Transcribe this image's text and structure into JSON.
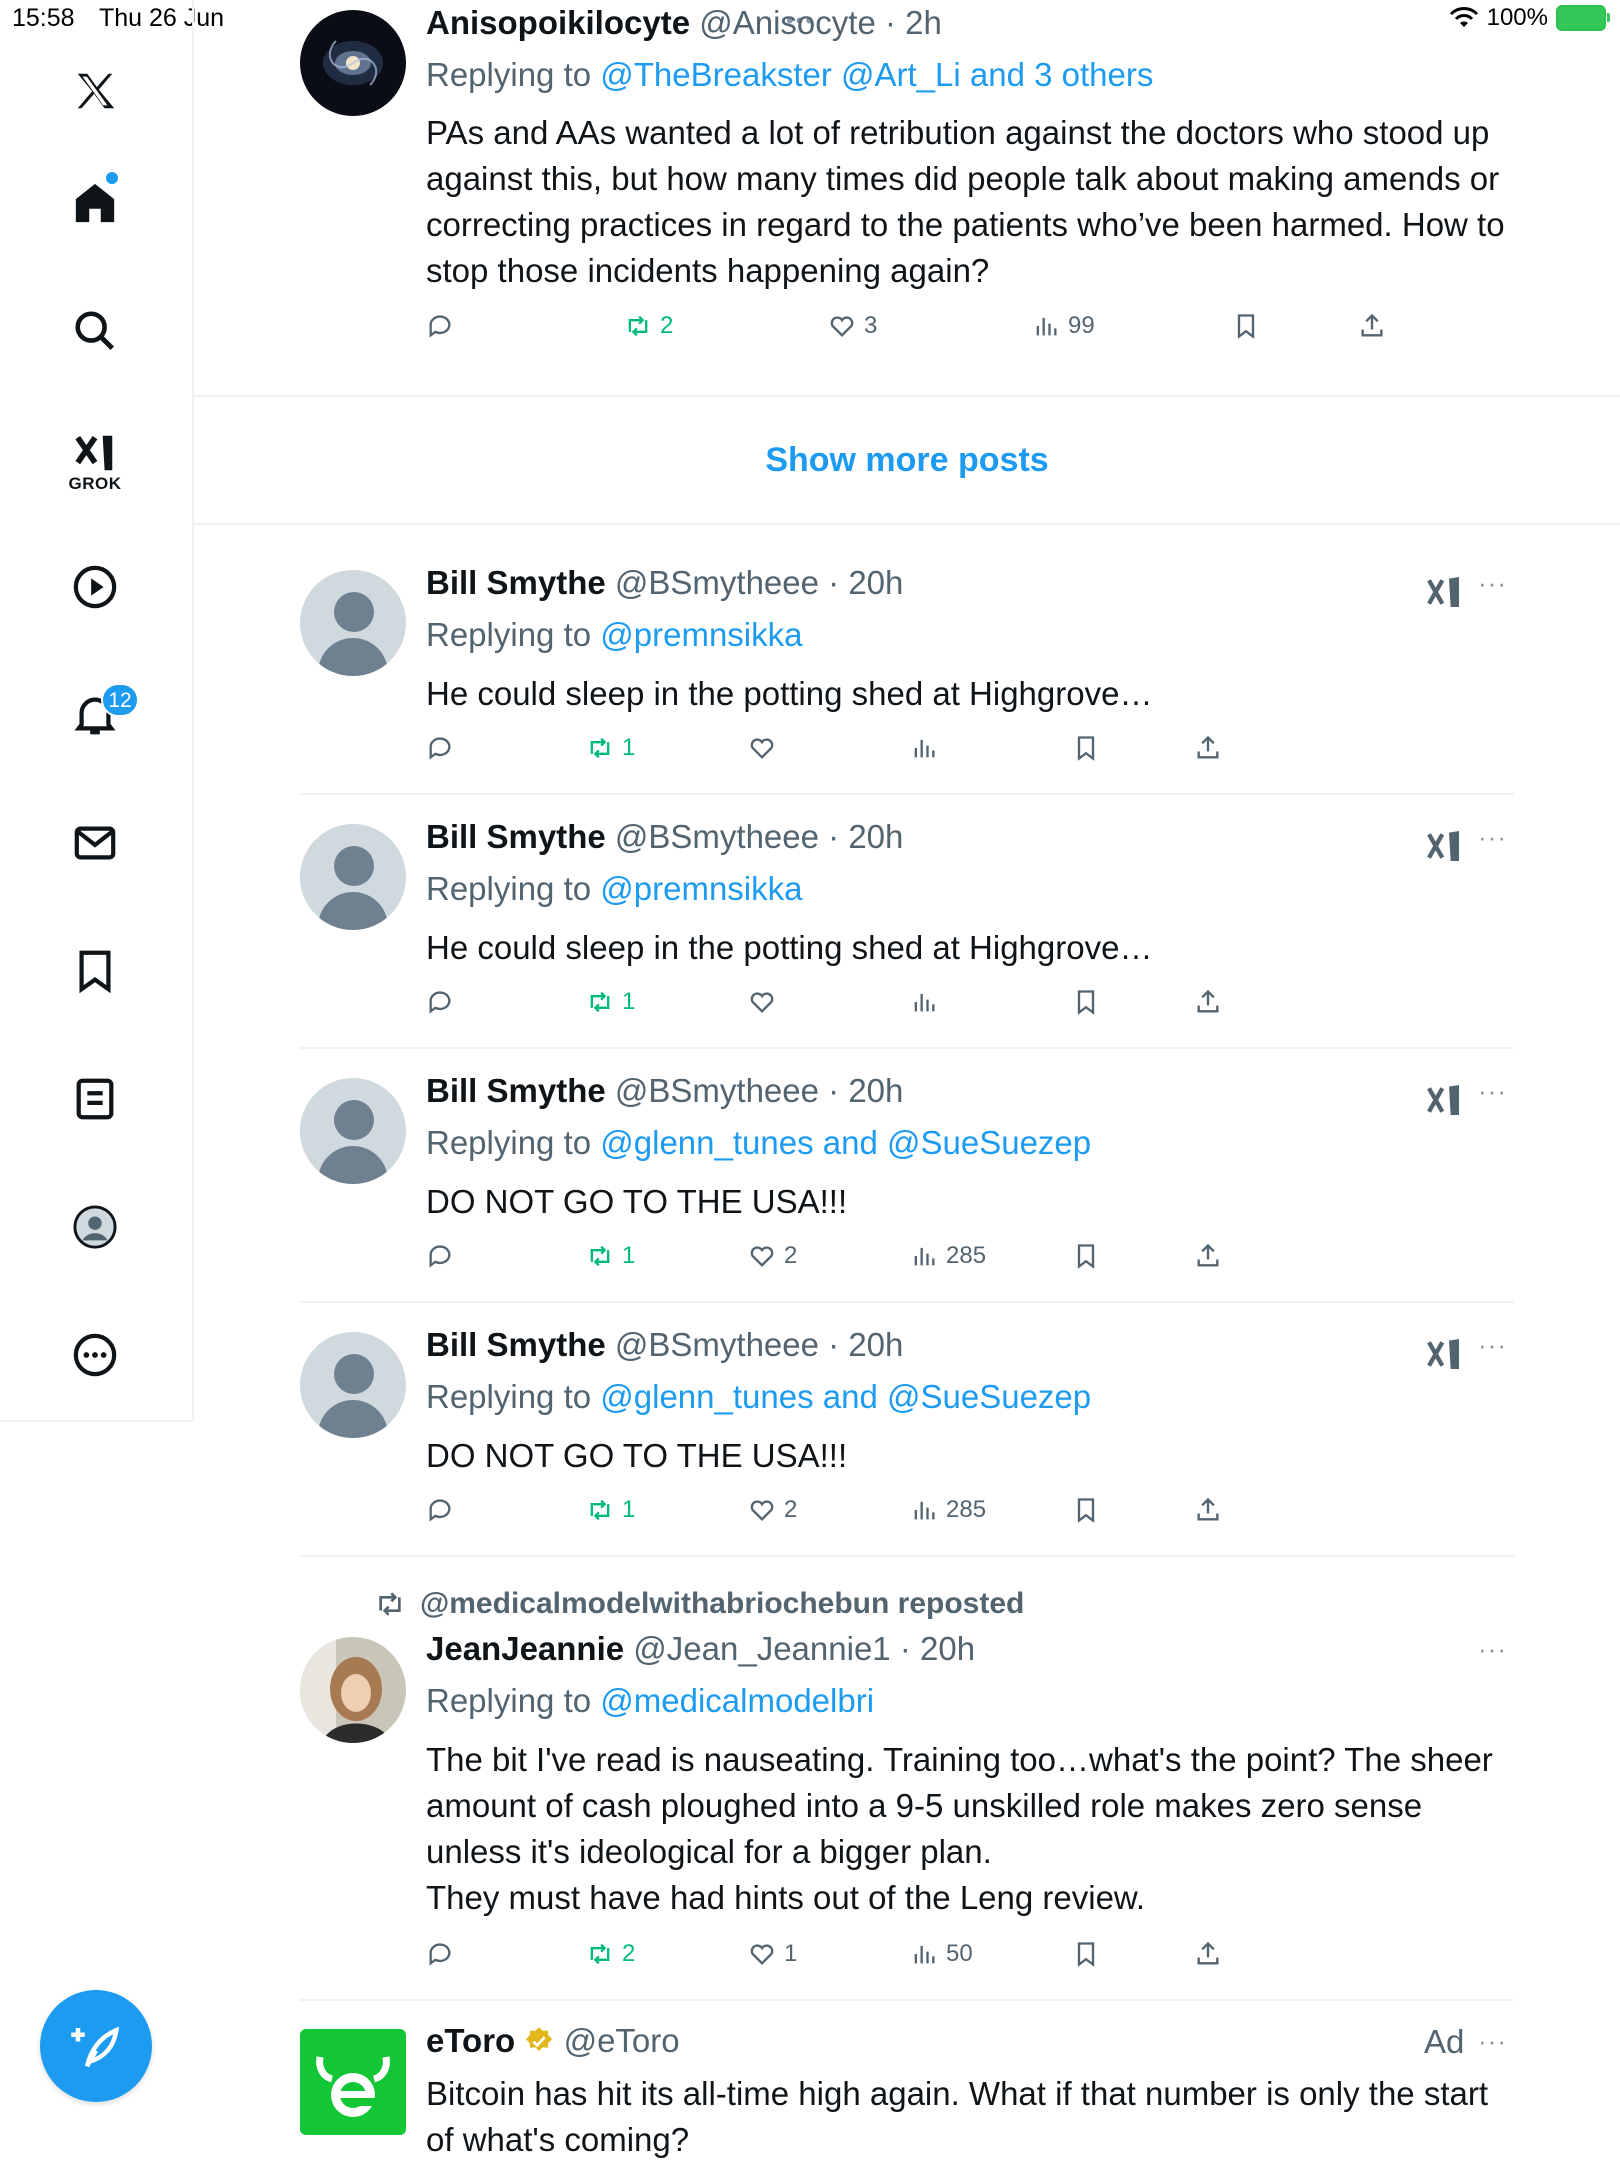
{
  "status": {
    "time": "15:58",
    "date": "Thu 26 Jun",
    "battery": "100%",
    "top_dots": "•••"
  },
  "sidebar": {
    "grok_label": "GROK",
    "notifications_badge": "12",
    "compose_label": "+"
  },
  "feed": {
    "show_more": "Show more posts"
  },
  "posts": [
    {
      "name": "Anisopoikilocyte",
      "handle": "@Anisocyte",
      "time": "· 2h",
      "replying_prefix": "Replying to ",
      "replying_to": "@TheBreakster @Art_Li and 3 others",
      "text": "PAs and AAs wanted a lot of retribution against the doctors who stood up against this, but how many times did people talk about making amends or correcting practices in regard to the patients who’ve been harmed. How to stop those incidents happening again?",
      "reposts": "2",
      "likes": "3",
      "views": "99"
    },
    {
      "name": "Bill Smythe",
      "handle": "@BSmytheee",
      "time": "· 20h",
      "replying_prefix": "Replying to ",
      "replying_to": "@premnsikka",
      "text": "He could sleep in the potting shed at Highgrove…",
      "reposts": "1",
      "likes": "",
      "views": "",
      "more": "···"
    },
    {
      "name": "Bill Smythe",
      "handle": "@BSmytheee",
      "time": "· 20h",
      "replying_prefix": "Replying to ",
      "replying_to": "@premnsikka",
      "text": "He could sleep in the potting shed at Highgrove…",
      "reposts": "1",
      "likes": "",
      "views": "",
      "more": "···"
    },
    {
      "name": "Bill Smythe",
      "handle": "@BSmytheee",
      "time": "· 20h",
      "replying_prefix": "Replying to ",
      "replying_to": "@glenn_tunes and @SueSuezep",
      "text": "DO NOT GO TO THE USA!!!",
      "reposts": "1",
      "likes": "2",
      "views": "285",
      "more": "···"
    },
    {
      "name": "Bill Smythe",
      "handle": "@BSmytheee",
      "time": "· 20h",
      "replying_prefix": "Replying to ",
      "replying_to": "@glenn_tunes and @SueSuezep",
      "text": "DO NOT GO TO THE USA!!!",
      "reposts": "1",
      "likes": "2",
      "views": "285",
      "more": "···"
    },
    {
      "repost_by": "@medicalmodelwithabriochebun reposted",
      "name": "JeanJeannie",
      "handle": "@Jean_Jeannie1",
      "time": "· 20h",
      "replying_prefix": "Replying to ",
      "replying_to": "@medicalmodelbri",
      "text_lines": [
        "The bit I've read is nauseating. Training too…what's the point? The sheer amount of cash ploughed into a 9-5 unskilled role makes zero sense unless it's ideological for a bigger plan.",
        "They must have had hints out of the Leng review."
      ],
      "reposts": "2",
      "likes": "1",
      "views": "50",
      "more": "···"
    },
    {
      "name": "eToro",
      "handle": "@eToro",
      "ad_label": "Ad",
      "more": "···",
      "text": "Bitcoin has hit its all-time high again.  What if that number is only the start of what's coming?"
    }
  ],
  "colors": {
    "accent": "#1d9bf0",
    "repost_green": "#00ba7c",
    "secondary_text": "#536471",
    "etoro_green": "#13c636"
  }
}
